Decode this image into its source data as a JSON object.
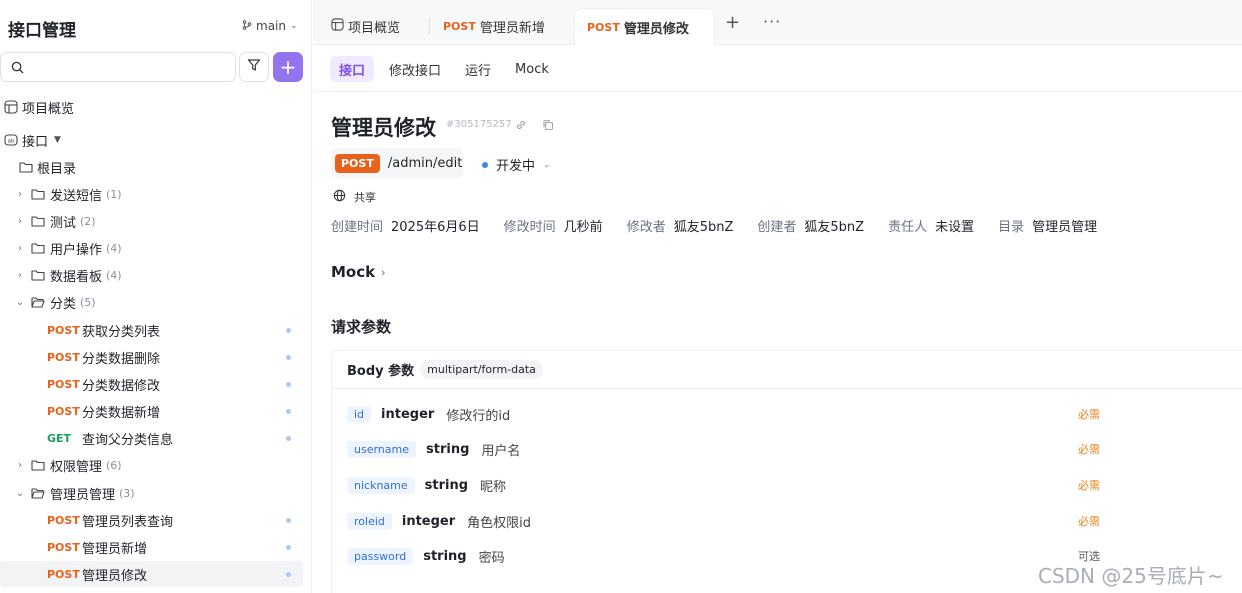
{
  "sidebar": {
    "title": "接口管理",
    "branch": "main",
    "search_placeholder": "",
    "add_label": "+",
    "tree": [
      {
        "label": "项目概览"
      },
      {
        "label": "接口"
      },
      {
        "label": "根目录"
      },
      {
        "label": "发送短信",
        "count": "(1)"
      },
      {
        "label": "测试",
        "count": "(2)"
      },
      {
        "label": "用户操作",
        "count": "(4)"
      },
      {
        "label": "数据看板",
        "count": "(4)"
      },
      {
        "label": "分类",
        "count": "(5)"
      },
      {
        "method": "POST",
        "label": "获取分类列表"
      },
      {
        "method": "POST",
        "label": "分类数据删除"
      },
      {
        "method": "POST",
        "label": "分类数据修改"
      },
      {
        "method": "POST",
        "label": "分类数据新增"
      },
      {
        "method": "GET",
        "label": "查询父分类信息"
      },
      {
        "label": "权限管理",
        "count": "(6)"
      },
      {
        "label": "管理员管理",
        "count": "(3)"
      },
      {
        "method": "POST",
        "label": "管理员列表查询"
      },
      {
        "method": "POST",
        "label": "管理员新增"
      },
      {
        "method": "POST",
        "label": "管理员修改"
      }
    ]
  },
  "tabs": [
    {
      "label": "项目概览"
    },
    {
      "method": "POST",
      "label": "管理员新增"
    },
    {
      "method": "POST",
      "label": "管理员修改"
    }
  ],
  "tabs_more": "···",
  "tabs_plus": "+",
  "subtabs": [
    "接口",
    "修改接口",
    "运行",
    "Mock"
  ],
  "api": {
    "title": "管理员修改",
    "id": "#305175257",
    "method": "POST",
    "path": "/admin/edit",
    "status": "开发中",
    "share": "共享",
    "meta": [
      {
        "key": "创建时间",
        "value": "2025年6月6日"
      },
      {
        "key": "修改时间",
        "value": "几秒前"
      },
      {
        "key": "修改者",
        "value": "狐友5bnZ"
      },
      {
        "key": "创建者",
        "value": "狐友5bnZ"
      },
      {
        "key": "责任人",
        "value": "未设置"
      },
      {
        "key": "目录",
        "value": "管理员管理"
      }
    ]
  },
  "mock_label": "Mock",
  "request_title": "请求参数",
  "body": {
    "label": "Body 参数",
    "content_type": "multipart/form-data",
    "params": [
      {
        "name": "id",
        "type": "integer",
        "desc": "修改行的id",
        "req": "必需"
      },
      {
        "name": "username",
        "type": "string",
        "desc": "用户名",
        "req": "必需"
      },
      {
        "name": "nickname",
        "type": "string",
        "desc": "昵称",
        "req": "必需"
      },
      {
        "name": "roleid",
        "type": "integer",
        "desc": "角色权限id",
        "req": "必需"
      },
      {
        "name": "password",
        "type": "string",
        "desc": "密码",
        "req": "可选"
      }
    ]
  },
  "watermark": "CSDN @25号底片~",
  "colors": {
    "accent": "#9373ee",
    "post": "#e8611d",
    "get": "#16a35a",
    "required": "#e8811d"
  }
}
